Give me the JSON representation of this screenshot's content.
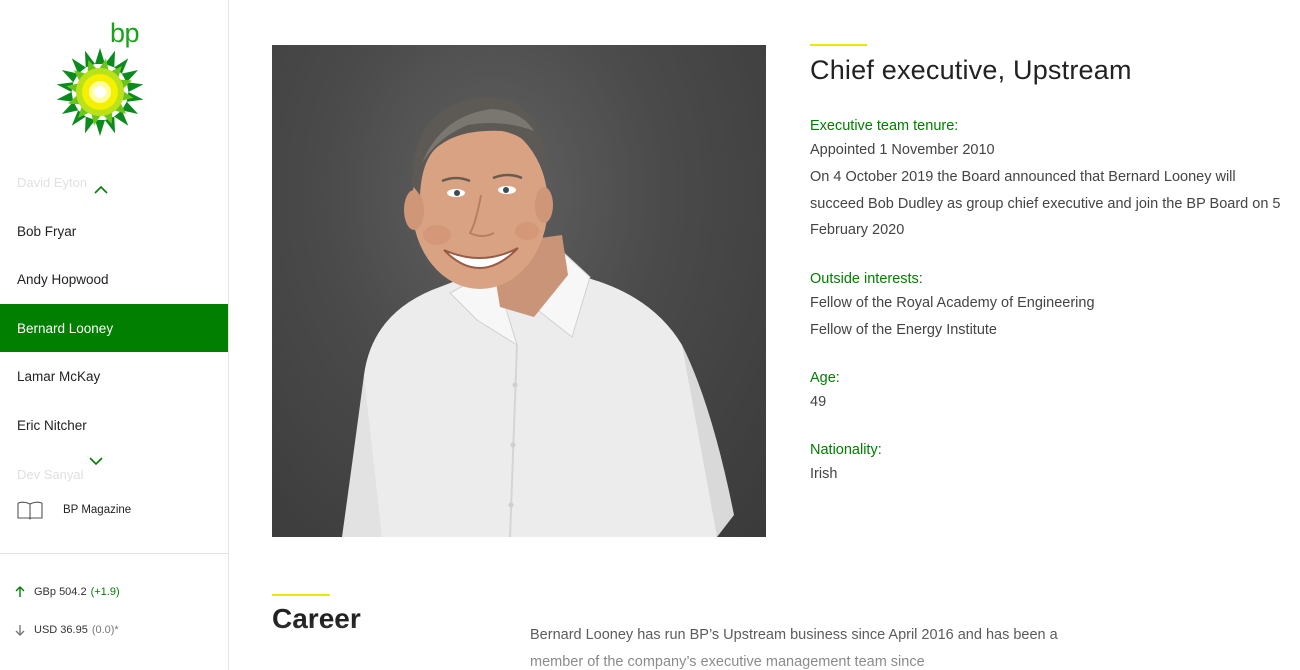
{
  "brand": {
    "logo_text": "bp",
    "green": "#007f00",
    "yellow": "#e9e900"
  },
  "sidebar": {
    "faded_above": "David Eyton",
    "faded_below": "Dev Sanyal",
    "items": [
      {
        "label": "Bob Fryar",
        "active": false
      },
      {
        "label": "Andy Hopwood",
        "active": false
      },
      {
        "label": "Bernard Looney",
        "active": true
      },
      {
        "label": "Lamar McKay",
        "active": false
      },
      {
        "label": "Eric Nitcher",
        "active": false
      }
    ],
    "magazine_label": "BP Magazine",
    "icons": {
      "scroll_up": "chevron-up-icon",
      "scroll_down": "chevron-down-icon",
      "magazine": "book-icon"
    }
  },
  "stock": {
    "gbp": {
      "label": "GBp 504.2",
      "change": "(+1.9)",
      "direction": "up"
    },
    "usd": {
      "label": "USD 36.95",
      "change": "(0.0)*",
      "direction": "down"
    }
  },
  "profile": {
    "role": "Chief executive, Upstream",
    "tenure_label": "Executive team tenure:",
    "tenure_text": "Appointed 1 November 2010",
    "tenure_note": "On 4 October 2019 the Board announced that Bernard Looney will succeed Bob Dudley as group chief executive and join the BP Board on 5 February 2020",
    "interests_label": "Outside interests:",
    "interests": [
      "Fellow of the Royal Academy of Engineering",
      "Fellow of the Energy Institute"
    ],
    "age_label": "Age:",
    "age": "49",
    "nationality_label": "Nationality:",
    "nationality": "Irish"
  },
  "career": {
    "title": "Career",
    "text": "Bernard Looney has run BP’s Upstream business since April 2016 and has been a member of the company’s executive management team since"
  }
}
